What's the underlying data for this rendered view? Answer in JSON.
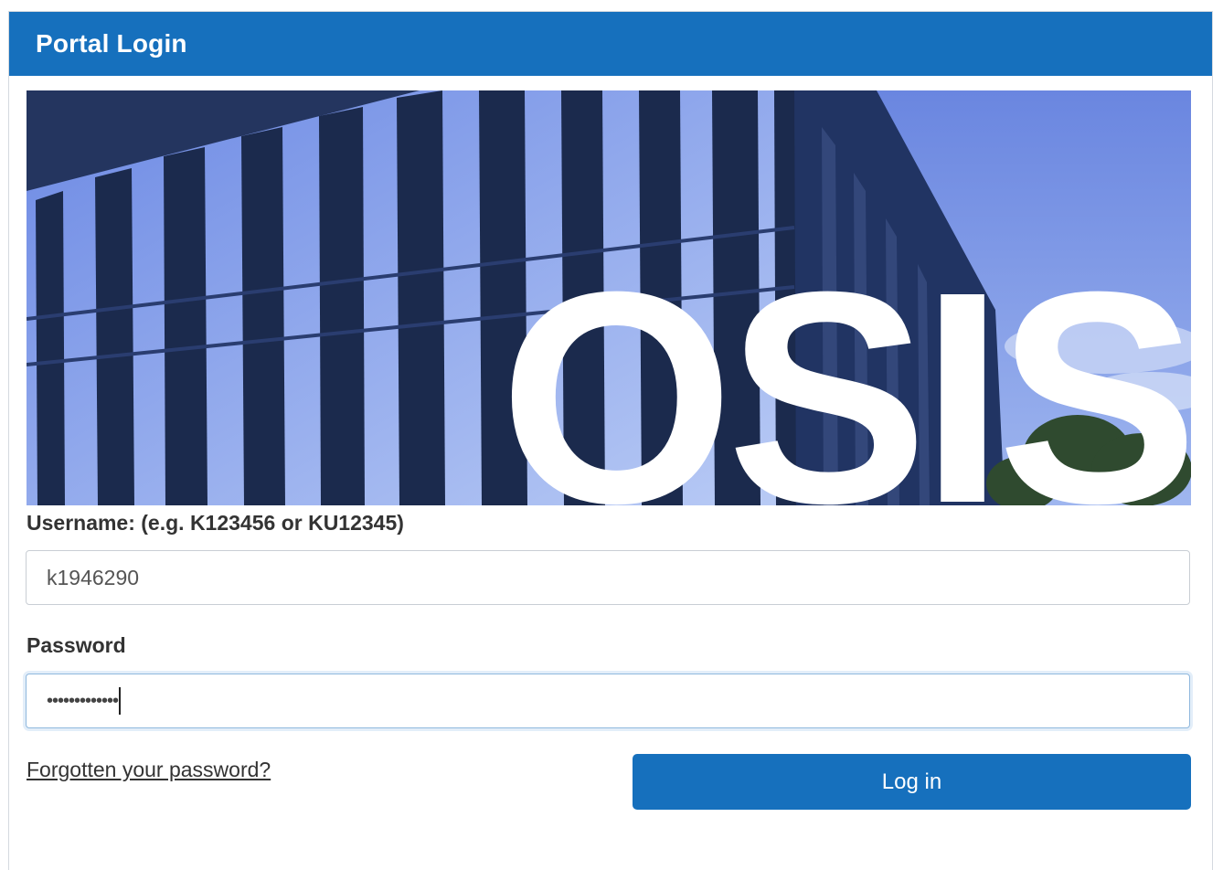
{
  "header": {
    "title": "Portal Login"
  },
  "banner": {
    "logo_text": "OSIS"
  },
  "form": {
    "username_label": "Username: (e.g. K123456 or KU12345)",
    "username_value": "k1946290",
    "password_label": "Password",
    "password_masked": "•••••••••••••",
    "forgot_link": "Forgotten your password?",
    "login_button": "Log in"
  },
  "colors": {
    "brand_blue": "#1670bd",
    "sky_blue": "#6f8fe6",
    "glass_dark": "#1b2a4d"
  }
}
